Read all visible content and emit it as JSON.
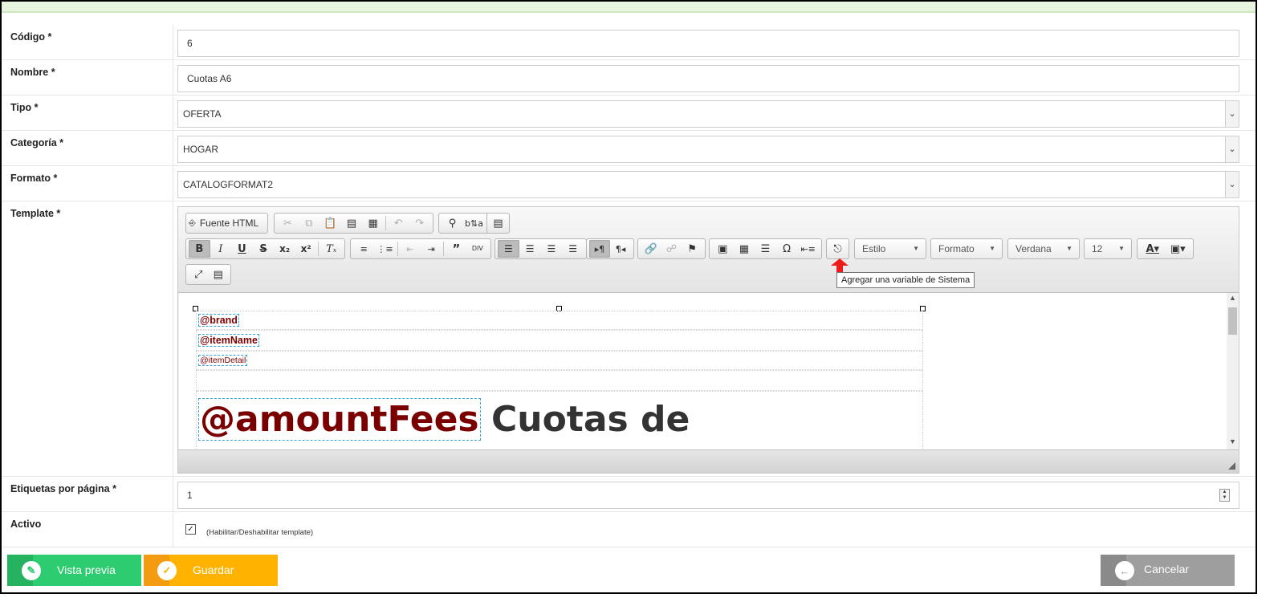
{
  "form": {
    "codigo": {
      "label": "Código *",
      "value": "6"
    },
    "nombre": {
      "label": "Nombre *",
      "value": "Cuotas A6"
    },
    "tipo": {
      "label": "Tipo *",
      "value": "OFERTA"
    },
    "categoria": {
      "label": "Categoría *",
      "value": "HOGAR"
    },
    "formato": {
      "label": "Formato *",
      "value": "CATALOGFORMAT2"
    },
    "template": {
      "label": "Template *"
    },
    "etiquetas": {
      "label": "Etiquetas por página *",
      "value": "1"
    },
    "activo": {
      "label": "Activo",
      "checked": true,
      "hint": "(Habilitar/Deshabilitar template)"
    }
  },
  "editor": {
    "source_button": "Fuente HTML",
    "combos": {
      "style": "Estilo",
      "format": "Formato",
      "font": "Verdana",
      "size": "12"
    },
    "tooltip": "Agregar una variable de Sistema",
    "icons": {
      "row1": [
        "cut-icon",
        "copy-icon",
        "paste-icon",
        "paste-text-icon",
        "paste-word-icon",
        "undo-icon",
        "redo-icon",
        "find-icon",
        "replace-icon",
        "select-all-icon"
      ],
      "row2": [
        "bold-icon",
        "italic-icon",
        "underline-icon",
        "strike-icon",
        "subscript-icon",
        "superscript-icon",
        "remove-format-icon",
        "numbered-list-icon",
        "bulleted-list-icon",
        "outdent-icon",
        "indent-icon",
        "blockquote-icon",
        "div-icon",
        "align-left-icon",
        "align-center-icon",
        "align-right-icon",
        "justify-icon",
        "ltr-icon",
        "rtl-icon",
        "link-icon",
        "unlink-icon",
        "anchor-icon",
        "image-icon",
        "table-icon",
        "horizontal-line-icon",
        "special-char-icon",
        "page-break-icon",
        "system-variable-icon",
        "text-color-icon",
        "background-color-icon",
        "maximize-icon",
        "show-blocks-icon"
      ]
    },
    "content": {
      "brand": "@brand",
      "item_name": "@itemName",
      "item_detail": "@itemDetail",
      "amount_fees": "@amountFees",
      "headline_text": "Cuotas de"
    }
  },
  "buttons": {
    "preview": "Vista previa",
    "save": "Guardar",
    "cancel": "Cancelar"
  },
  "colors": {
    "preview": "#2ecc71",
    "save": "#ffb300",
    "cancel": "#9e9e9e",
    "variable": "#7a0000"
  }
}
